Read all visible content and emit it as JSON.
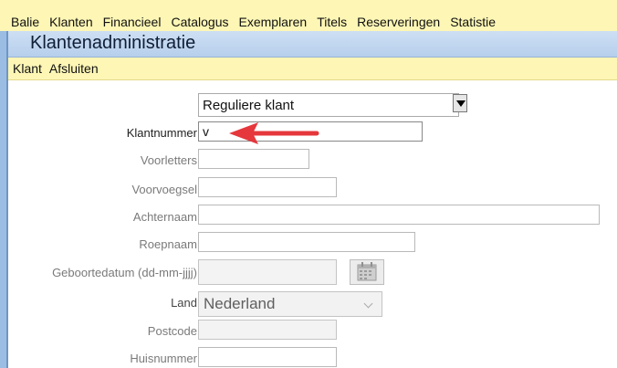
{
  "menubar": {
    "items": [
      "Balie",
      "Klanten",
      "Financieel",
      "Catalogus",
      "Exemplaren",
      "Titels",
      "Reserveringen",
      "Statistie"
    ]
  },
  "window": {
    "title": "Klantenadministratie"
  },
  "submenu": {
    "items": [
      "Klant",
      "Afsluiten"
    ]
  },
  "form": {
    "klant_type": {
      "value": "Reguliere klant"
    },
    "fields": {
      "klantnummer": {
        "label": "Klantnummer",
        "value": "v"
      },
      "voorletters": {
        "label": "Voorletters",
        "value": ""
      },
      "voorvoegsel": {
        "label": "Voorvoegsel",
        "value": ""
      },
      "achternaam": {
        "label": "Achternaam",
        "value": ""
      },
      "roepnaam": {
        "label": "Roepnaam",
        "value": ""
      },
      "geboortedatum": {
        "label": "Geboortedatum (dd-mm-jjjj)",
        "value": ""
      },
      "land": {
        "label": "Land",
        "value": "Nederland"
      },
      "postcode": {
        "label": "Postcode",
        "value": ""
      },
      "huisnummer": {
        "label": "Huisnummer",
        "value": ""
      }
    }
  },
  "annotation": {
    "arrow_color": "#e5373c"
  },
  "icons": {
    "calendar": "calendar-icon",
    "dropdown": "chevron-down-icon"
  }
}
